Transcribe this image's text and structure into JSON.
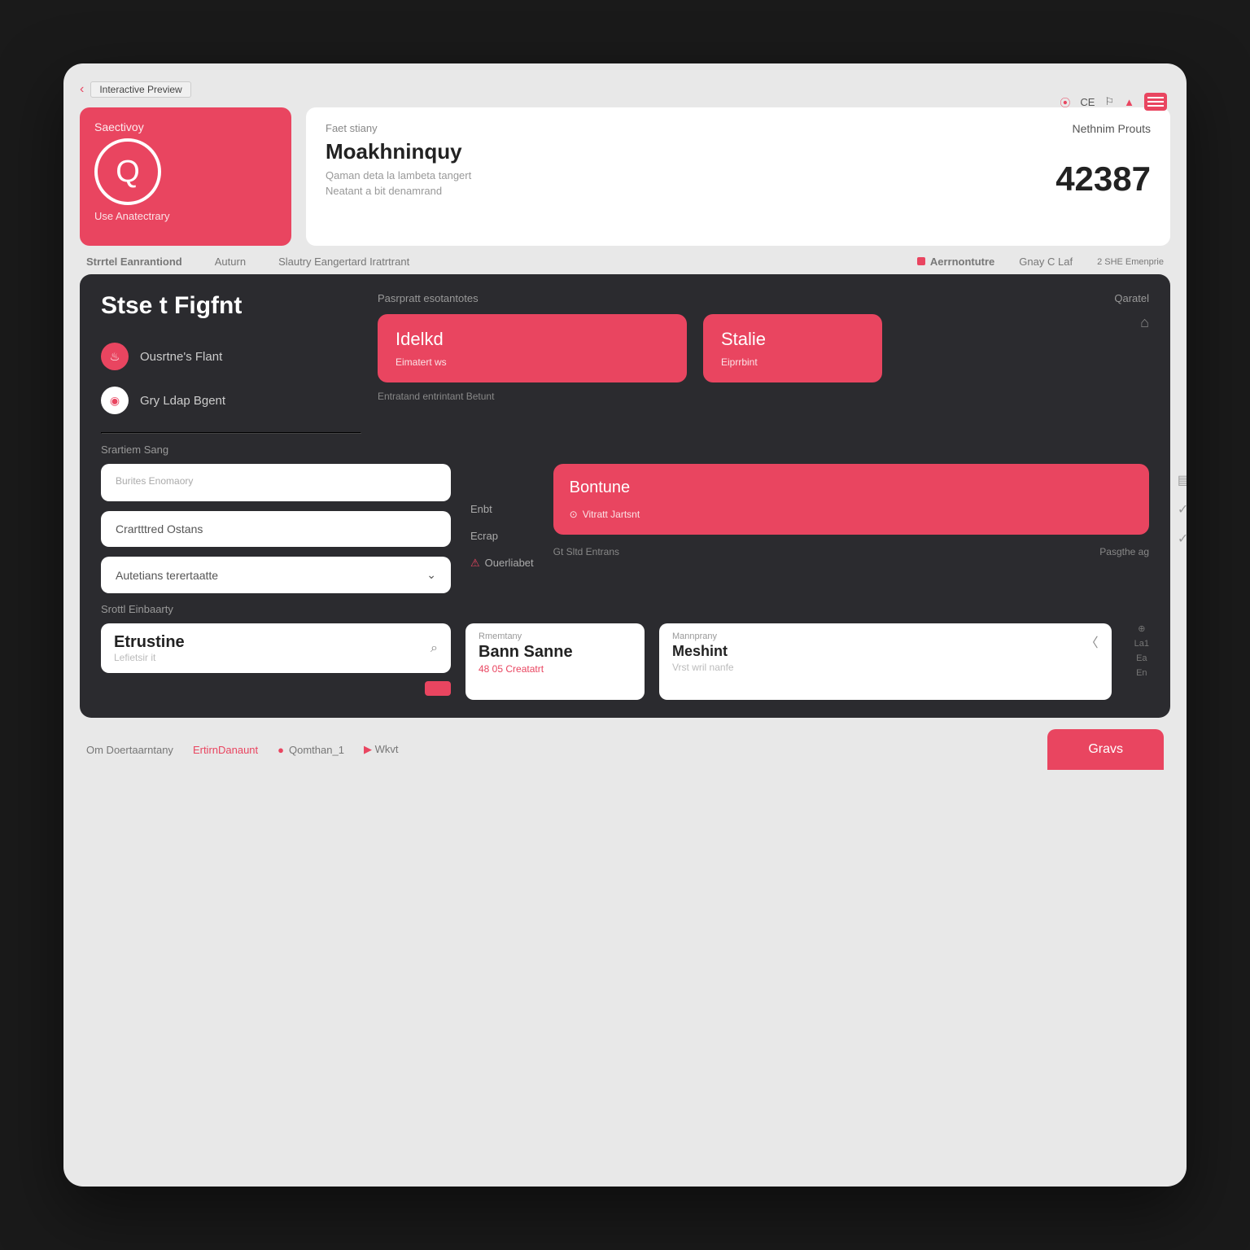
{
  "titlebar": {
    "tab": "Interactive Preview"
  },
  "topstrip": {
    "label": "CE"
  },
  "brand": {
    "label": "Saectivoy",
    "sub": "Use Anatectrary"
  },
  "info": {
    "kicker": "Faet stiany",
    "title": "Moakhninquy",
    "desc1": "Qaman deta la lambeta tangert",
    "desc2": "Neatant a bit denamrand",
    "right_kicker": "Nethnim Prouts",
    "number": "42387"
  },
  "subnav": {
    "a": "Strrtel Eanrantiond",
    "b": "Auturn",
    "c": "Slautry Eangertard Iratrtrant",
    "r1": "Aerrnontutre",
    "r2": "Gnay C Laf",
    "r3": "2 SHE Emenprie"
  },
  "panel": {
    "title": "Stse t Figfnt",
    "nav1": "Ousrtne's Flant",
    "nav2": "Gry Ldap Bgent",
    "sect": "Srartiem Sang",
    "top_label": "Pasrpratt esotantotes",
    "top_right": "Qaratel",
    "pill1_t": "Idelkd",
    "pill1_s": "Eimatert ws",
    "pill2_t": "Stalie",
    "pill2_s": "Eiprrbint",
    "mid": "Entratand entrintant Betunt",
    "form_lab": "Burites Enomaory",
    "opt1": "Crartttred Ostans",
    "opt2": "Autetians terertaatte",
    "dlabel": "Srottl Einbaarty",
    "m1": "Enbt",
    "m2": "Ecrap",
    "m3": "Ouerliabet",
    "cont_t": "Bontune",
    "cont_s": "Vitratt Jartsnt",
    "low_l": "Gt Sltd Entrans",
    "low_r": "Pasgthe ag",
    "search_t": "Etrustine",
    "search_ph": "Lefietsir it",
    "c1_k": "Rmemtany",
    "c1_v": "Bann Sanne",
    "c1_d": "48 05 Creatatrt",
    "c2_k": "Mannprany",
    "c2_v": "Meshint",
    "c2_ph": "Vrst wril nanfe",
    "side_a": "La1",
    "side_b": "Ea",
    "side_c": "En"
  },
  "footer": {
    "a": "Om Doertaarntany",
    "b": "ErtirnDanaunt",
    "c": "Qomthan_1",
    "d": "Wkvt",
    "cta": "Gravs"
  }
}
